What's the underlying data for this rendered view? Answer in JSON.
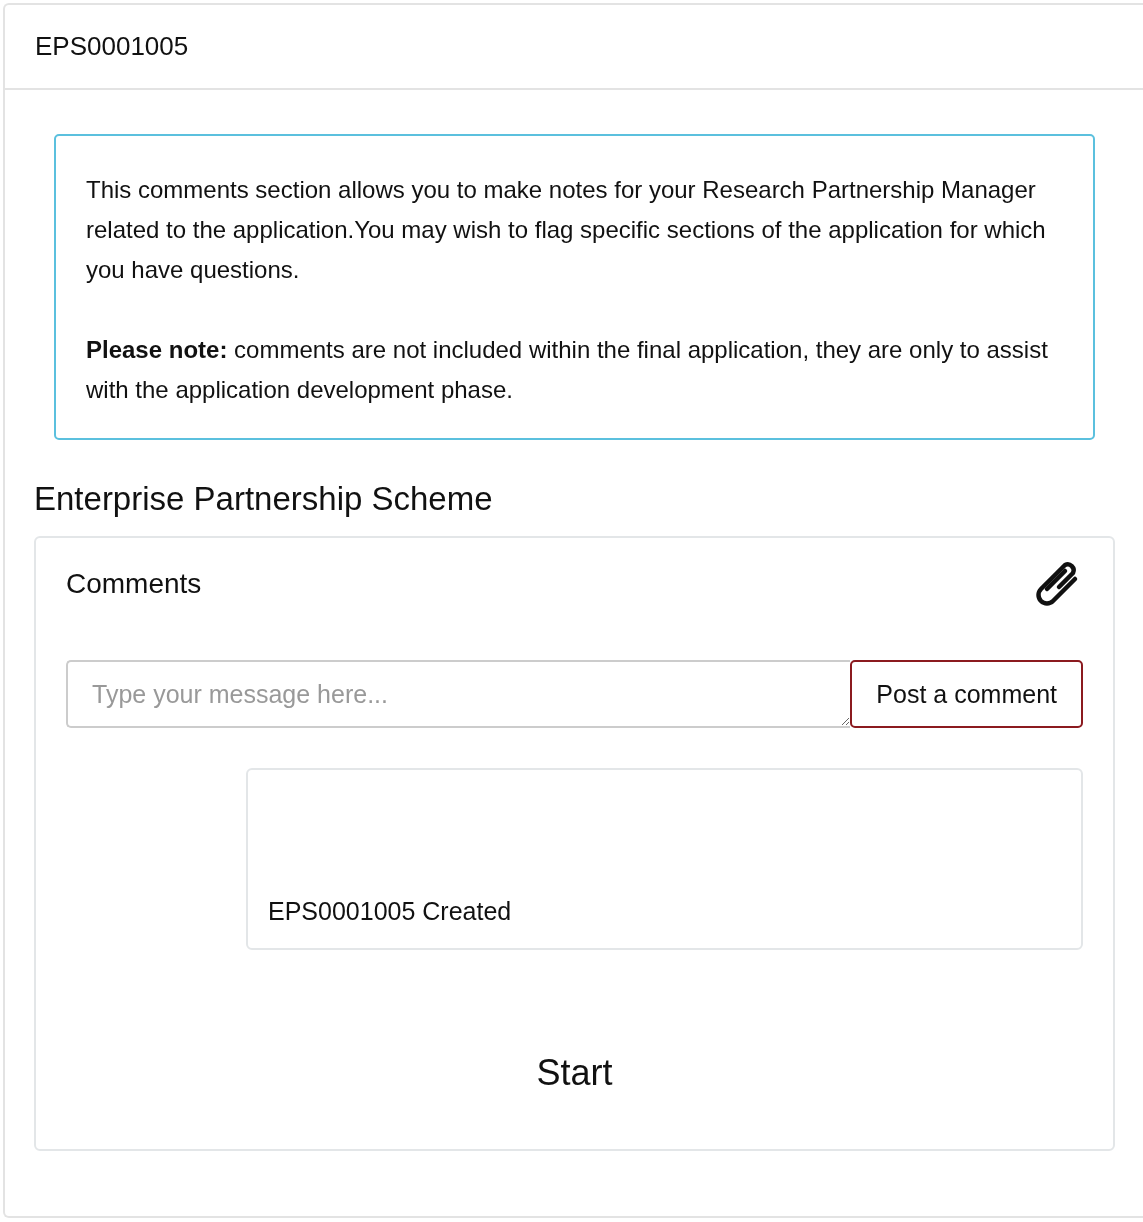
{
  "panel": {
    "title": "EPS0001005"
  },
  "info": {
    "paragraphs": [
      "This comments section allows you to make notes for your Research Partnership Manager related to the application.You may wish to flag specific sections of the application for which you have questions.",
      "**Please note:** comments are not included within the final application, they are only to assist with the application development phase."
    ]
  },
  "section_title": "Enterprise Partnership Scheme",
  "comments": {
    "title": "Comments",
    "message": {
      "placeholder": "Type your message here..."
    },
    "post_button": "Post a comment",
    "entries": [
      {
        "text": "EPS0001005 Created"
      }
    ],
    "timeline_label": "Start"
  }
}
